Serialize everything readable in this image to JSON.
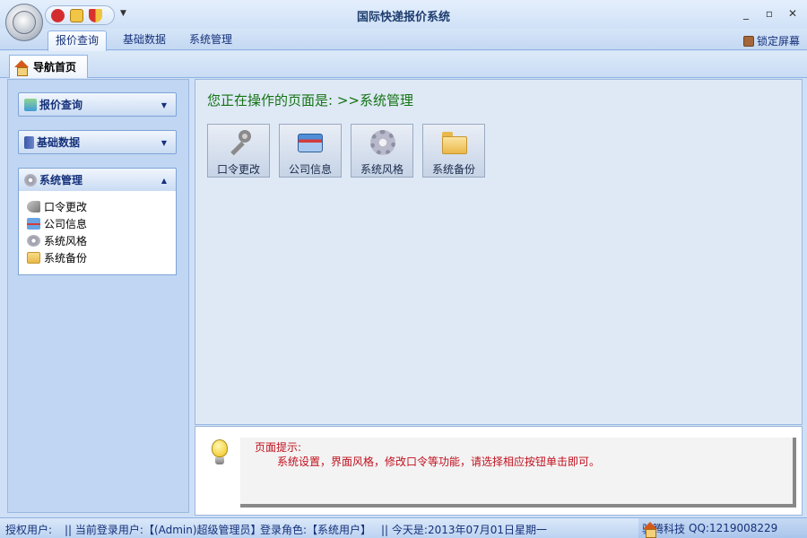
{
  "window": {
    "title": "国际快递报价系统"
  },
  "ribbon": {
    "tabs": [
      "报价查询",
      "基础数据",
      "系统管理"
    ],
    "active_tab": "报价查询",
    "lock_label": "锁定屏幕"
  },
  "doc_tab": {
    "label": "导航首页"
  },
  "sidebar": {
    "groups": [
      {
        "label": "报价查询",
        "chevron": "▼"
      },
      {
        "label": "基础数据",
        "chevron": "▼"
      },
      {
        "label": "系统管理",
        "chevron": "▲"
      }
    ],
    "items": [
      "口令更改",
      "公司信息",
      "系统风格",
      "系统备份"
    ]
  },
  "main": {
    "page_heading": "您正在操作的页面是: >>系统管理",
    "tiles": [
      {
        "label": "口令更改",
        "icon": "key-icon"
      },
      {
        "label": "公司信息",
        "icon": "card-icon"
      },
      {
        "label": "系统风格",
        "icon": "gear-icon"
      },
      {
        "label": "系统备份",
        "icon": "folder-icon"
      }
    ]
  },
  "hint": {
    "title": "页面提示:",
    "text": "系统设置，界面风格，修改口令等功能，请选择相应按钮单击即可。"
  },
  "status": {
    "licensed_user": "授权用户:",
    "current_user": "|| 当前登录用户:【(Admin)超级管理员】",
    "role": "登录角色:【系统用户】",
    "date": "|| 今天是:2013年07月01日星期一",
    "company": "骏腾科技",
    "qq": "QQ:1219008229"
  },
  "colors": {
    "accent": "#15317a",
    "heading_green": "#137313",
    "hint_red": "#c0101e"
  }
}
